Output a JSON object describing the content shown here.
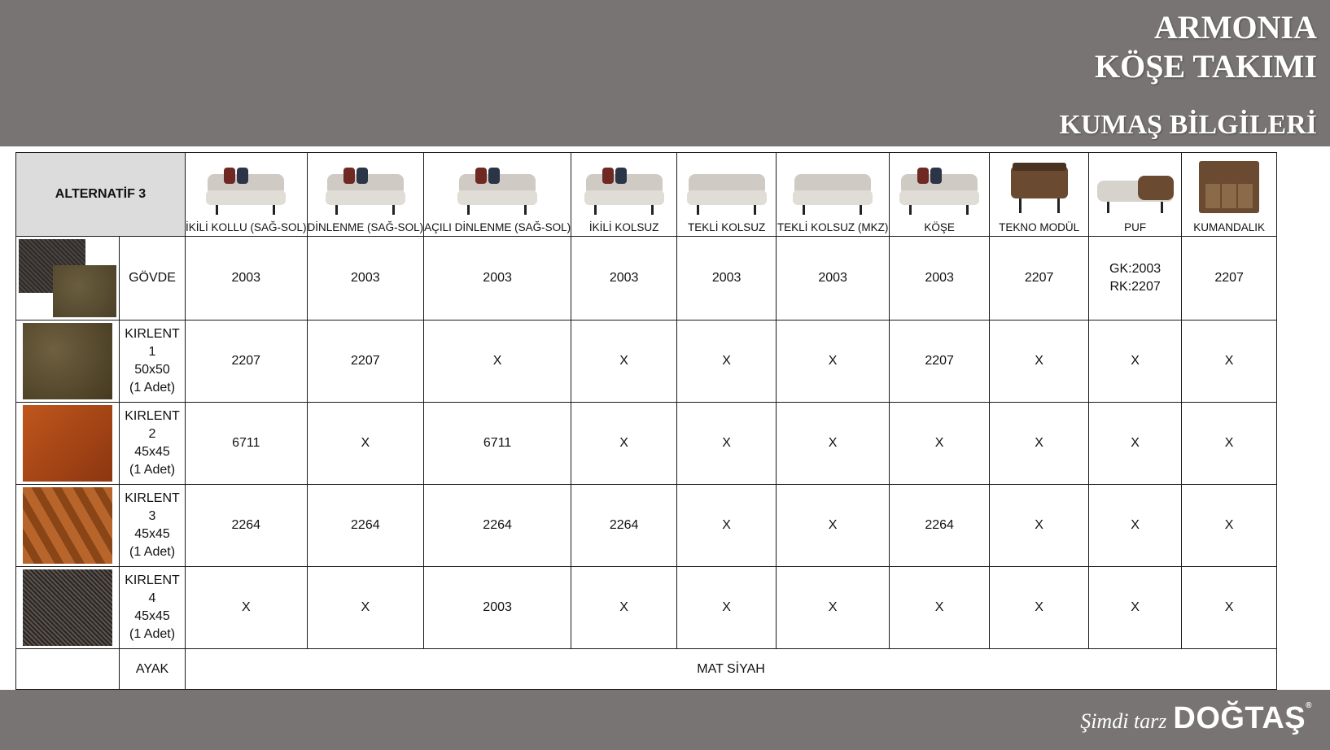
{
  "header": {
    "title_line1": "ARMONIA",
    "title_line2": "KÖŞE TAKIMI",
    "subtitle": "KUMAŞ BİLGİLERİ"
  },
  "table": {
    "alternative": "ALTERNATİF 3",
    "products": [
      "İKİLİ KOLLU (SAĞ-SOL)",
      "DİNLENME (SAĞ-SOL)",
      "AÇILI DİNLENME (SAĞ-SOL)",
      "İKİLİ KOLSUZ",
      "TEKLİ KOLSUZ",
      "TEKLİ KOLSUZ (MKZ)",
      "KÖŞE",
      "TEKNO MODÜL",
      "PUF",
      "KUMANDALIK"
    ],
    "rows": [
      {
        "label": [
          "GÖVDE"
        ],
        "values": [
          "2003",
          "2003",
          "2003",
          "2003",
          "2003",
          "2003",
          "2003",
          "2207",
          "GK:2003\nRK:2207",
          "2207"
        ]
      },
      {
        "label": [
          "KIRLENT 1",
          "50x50",
          "(1 Adet)"
        ],
        "values": [
          "2207",
          "2207",
          "X",
          "X",
          "X",
          "X",
          "2207",
          "X",
          "X",
          "X"
        ]
      },
      {
        "label": [
          "KIRLENT 2",
          "45x45",
          "(1 Adet)"
        ],
        "values": [
          "6711",
          "X",
          "6711",
          "X",
          "X",
          "X",
          "X",
          "X",
          "X",
          "X"
        ]
      },
      {
        "label": [
          "KIRLENT 3",
          "45x45",
          "(1 Adet)"
        ],
        "values": [
          "2264",
          "2264",
          "2264",
          "2264",
          "X",
          "X",
          "2264",
          "X",
          "X",
          "X"
        ]
      },
      {
        "label": [
          "KIRLENT 4",
          "45x45",
          "(1 Adet)"
        ],
        "values": [
          "X",
          "X",
          "2003",
          "X",
          "X",
          "X",
          "X",
          "X",
          "X",
          "X"
        ]
      }
    ],
    "legs": {
      "label": "AYAK",
      "value": "MAT SİYAH"
    }
  },
  "footer": {
    "tagline": "Şimdi tarz",
    "brand": "DOĞTAŞ",
    "reg": "®"
  },
  "colors": {
    "band": "#787474",
    "alt_cell": "#dcdcdc",
    "border": "#1a1a1a"
  }
}
